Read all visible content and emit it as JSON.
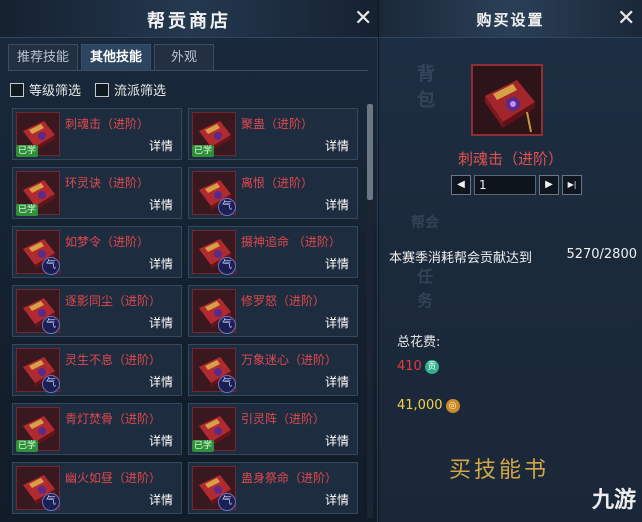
{
  "shop": {
    "title": "帮贡商店",
    "close_icon": "✕",
    "tabs": [
      {
        "label": "推荐技能",
        "active": false
      },
      {
        "label": "其他技能",
        "active": true
      },
      {
        "label": "外观",
        "active": false
      }
    ],
    "filters": [
      {
        "label": "等级筛选",
        "checked": false
      },
      {
        "label": "流派筛选",
        "checked": false
      }
    ],
    "detail_label": "详情",
    "learned_label": "已学",
    "school_icon_glyph": "气",
    "items": [
      {
        "name": "刺魂击（进阶）",
        "learned": true
      },
      {
        "name": "聚蛊（进阶）",
        "learned": true
      },
      {
        "name": "环灵诀（进阶）",
        "learned": true
      },
      {
        "name": "离恨（进阶）",
        "learned": false
      },
      {
        "name": "如梦令（进阶）",
        "learned": false
      },
      {
        "name": "摄神追命 （进阶）",
        "learned": false
      },
      {
        "name": "逐影同尘（进阶）",
        "learned": false
      },
      {
        "name": "修罗怒（进阶）",
        "learned": false
      },
      {
        "name": "灵生不息（进阶）",
        "learned": false
      },
      {
        "name": "万象迷心（进阶）",
        "learned": false
      },
      {
        "name": "青灯焚骨（进阶）",
        "learned": true
      },
      {
        "name": "引灵阵（进阶）",
        "learned": true
      },
      {
        "name": "幽火如昼（进阶）",
        "learned": false
      },
      {
        "name": "蛊身祭命（进阶）",
        "learned": false
      }
    ]
  },
  "purchase": {
    "title": "购买设置",
    "close_icon": "✕",
    "item_name": "刺魂击（进阶）",
    "quantity": "1",
    "decrease_icon": "◀",
    "increase_icon": "▶",
    "max_icon": "▶|",
    "requirement_label": "本赛季消耗帮会贡献达到",
    "requirement_value": "5270/2800",
    "total_label": "总花费:",
    "cost_contribution": "410",
    "cost_contribution_icon": "贡",
    "cost_silver": "41,000",
    "cost_silver_icon": "◎",
    "bg_text_1": "背包",
    "bg_text_2": "任务",
    "bg_text_3": "帮会",
    "banner_text": "买技能书",
    "watermark": "九游",
    "colors": {
      "item_name": "#e35050",
      "contribution_cost": "#e33a3a",
      "silver_cost": "#f2d24a",
      "contribution_icon": "#2fb08a",
      "silver_icon": "#c98a2a"
    }
  }
}
